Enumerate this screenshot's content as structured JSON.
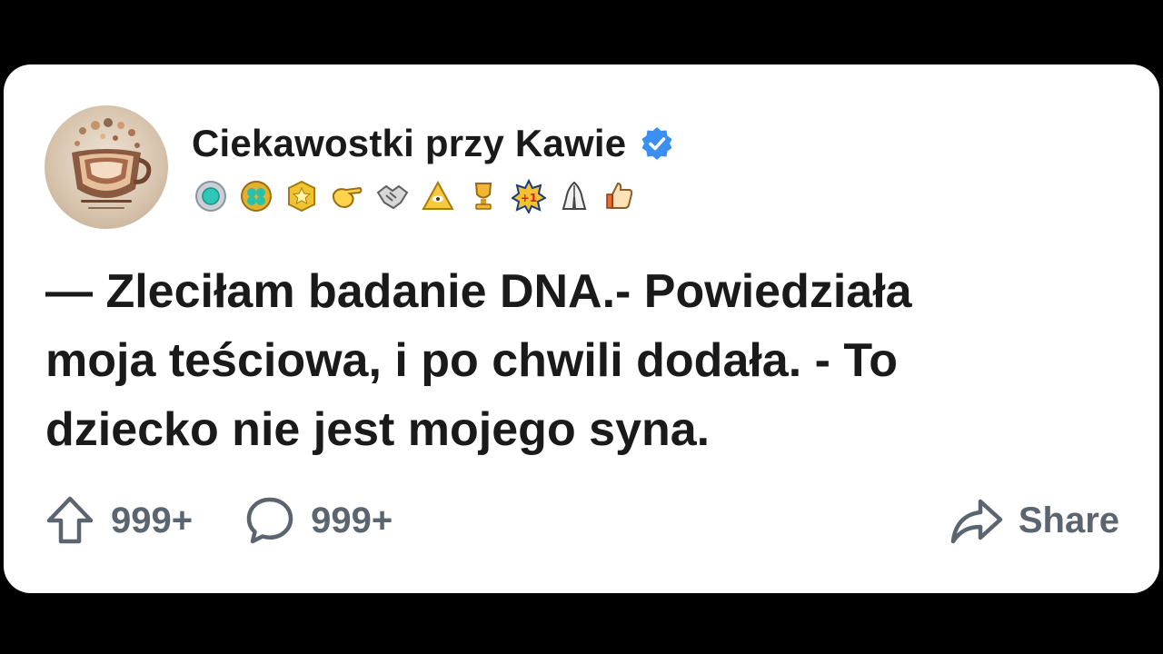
{
  "post": {
    "author": "Ciekawostki przy Kawie",
    "verified": true,
    "awards": [
      "silver-medal-icon",
      "gold-clover-icon",
      "gold-star-badge-icon",
      "pointing-hand-icon",
      "handshake-icon",
      "pyramid-eye-icon",
      "trophy-icon",
      "plus-one-badge-icon",
      "praying-hands-icon",
      "thumbs-up-icon"
    ],
    "text": "— Zleciłam badanie DNA.- Powiedziała\nmoja teściowa, i po chwili dodała. - To\ndziecko nie jest mojego syna.",
    "upvotes": "999+",
    "comments": "999+",
    "share_label": "Share"
  },
  "colors": {
    "background": "#000000",
    "card": "#ffffff",
    "text": "#1a1a1b",
    "muted": "#5b6570",
    "verified": "#3b8ff0"
  }
}
